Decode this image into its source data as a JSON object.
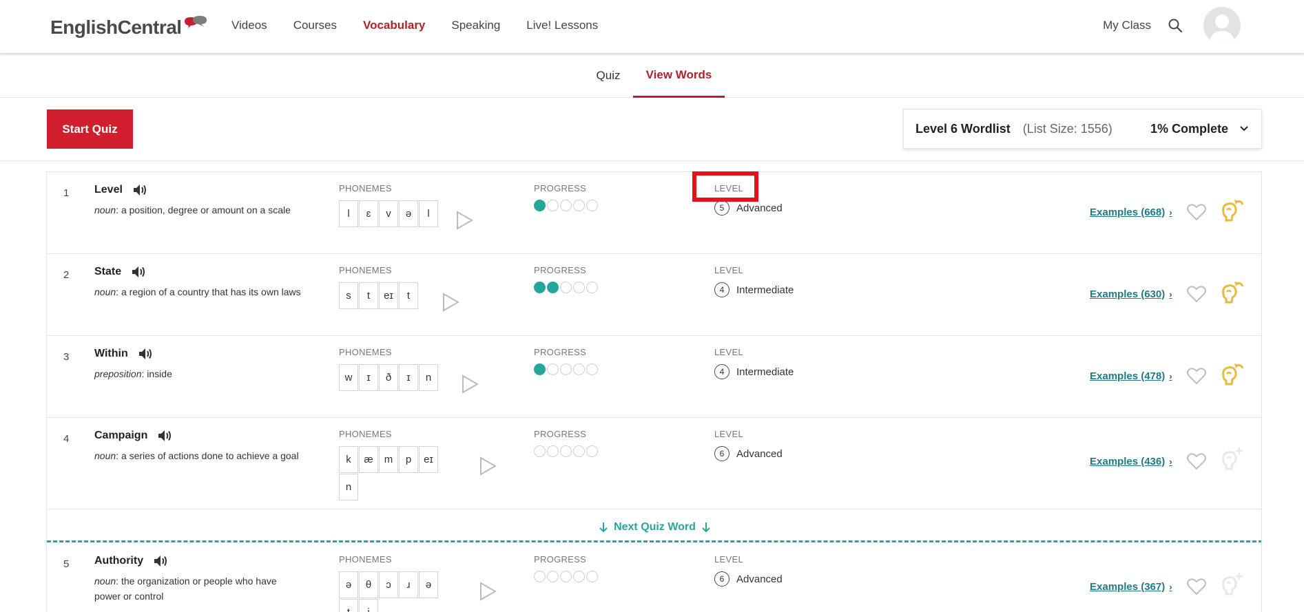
{
  "header": {
    "logo_text": "EnglishCentral",
    "nav": [
      "Videos",
      "Courses",
      "Vocabulary",
      "Speaking",
      "Live! Lessons"
    ],
    "active_nav": "Vocabulary",
    "my_class": "My Class"
  },
  "tabs": {
    "quiz": "Quiz",
    "view_words": "View Words",
    "active": "View Words"
  },
  "toolbar": {
    "start_quiz": "Start Quiz",
    "wordlist_title": "Level 6 Wordlist",
    "list_size": "(List Size: 1556)",
    "complete": "1% Complete"
  },
  "labels": {
    "phonemes": "PHONEMES",
    "progress": "PROGRESS",
    "level": "LEVEL"
  },
  "next_quiz_word": "Next Quiz Word",
  "colors": {
    "brand_red": "#d11f2e",
    "teal": "#26a69a",
    "link": "#1f7a85",
    "gold": "#e8b93b"
  },
  "words": [
    {
      "num": "1",
      "word": "Level",
      "pos": "noun",
      "definition": "a position, degree or amount on a scale",
      "phonemes": [
        "l",
        "ɛ",
        "v",
        "ə",
        "l"
      ],
      "progress": 1,
      "level_num": "5",
      "level_name": "Advanced",
      "examples_label": "Examples",
      "examples_count": "(668)",
      "brain": "review"
    },
    {
      "num": "2",
      "word": "State",
      "pos": "noun",
      "definition": "a region of a country that has its own laws",
      "phonemes": [
        "s",
        "t",
        "eɪ",
        "t"
      ],
      "progress": 2,
      "level_num": "4",
      "level_name": "Intermediate",
      "examples_label": "Examples",
      "examples_count": "(630)",
      "brain": "review"
    },
    {
      "num": "3",
      "word": "Within",
      "pos": "preposition",
      "definition": "inside",
      "phonemes": [
        "w",
        "ɪ",
        "ð",
        "ɪ",
        "n"
      ],
      "progress": 1,
      "level_num": "4",
      "level_name": "Intermediate",
      "examples_label": "Examples",
      "examples_count": "(478)",
      "brain": "review"
    },
    {
      "num": "4",
      "word": "Campaign",
      "pos": "noun",
      "definition": "a series of actions done to achieve a goal",
      "phonemes": [
        "k",
        "æ",
        "m",
        "p",
        "eɪ",
        "n"
      ],
      "progress": 0,
      "level_num": "6",
      "level_name": "Advanced",
      "examples_label": "Examples",
      "examples_count": "(436)",
      "brain": "add"
    },
    {
      "num": "5",
      "word": "Authority",
      "pos": "noun",
      "definition": "the organization or people who have power or control",
      "phonemes": [
        "ə",
        "θ",
        "ɔ",
        "ɹ",
        "ə",
        "t",
        "i"
      ],
      "progress": 0,
      "level_num": "6",
      "level_name": "Advanced",
      "examples_label": "Examples",
      "examples_count": "(367)",
      "brain": "add"
    }
  ]
}
